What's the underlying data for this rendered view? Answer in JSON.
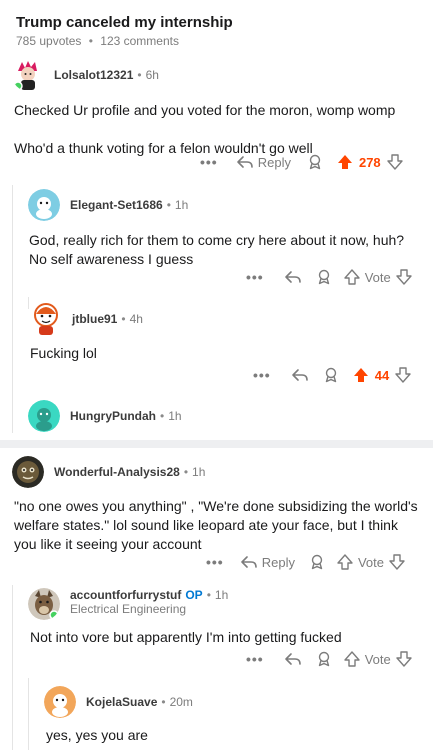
{
  "post": {
    "title": "Trump canceled my internship",
    "upvotes": "785 upvotes",
    "comments": "123 comments"
  },
  "comments": [
    {
      "author": "Lolsalot12321",
      "time": "6h",
      "body": [
        "Checked Ur profile and you voted for the moron, womp womp",
        "Who'd a thunk voting for a felon wouldn't go well"
      ],
      "reply_label": "Reply",
      "votes": "278"
    },
    {
      "author": "Elegant-Set1686",
      "time": "1h",
      "body": [
        "God, really rich for them to come cry here about it now, huh? No self awareness I guess"
      ],
      "votes": "Vote"
    },
    {
      "author": "jtblue91",
      "time": "4h",
      "body": [
        "Fucking lol"
      ],
      "votes": "44"
    },
    {
      "author": "HungryPundah",
      "time": "1h"
    },
    {
      "author": "Wonderful-Analysis28",
      "time": "1h",
      "body": [
        "\"no one owes you anything\" , \"We're done subsidizing the world's welfare states.\" lol sound like leopard ate your face, but I think you like it seeing your account"
      ],
      "reply_label": "Reply",
      "votes": "Vote"
    },
    {
      "author": "accountforfurrystuf",
      "op": "OP",
      "time": "1h",
      "flair": "Electrical Engineering",
      "body": [
        "Not into vore but apparently I'm into getting fucked"
      ],
      "votes": "Vote"
    },
    {
      "author": "KojelaSuave",
      "time": "20m",
      "body": [
        "yes, yes you are"
      ]
    }
  ],
  "icons": {
    "more": "more-icon",
    "reply": "reply-arrow-icon",
    "award": "award-icon",
    "upvote": "upvote-arrow-icon",
    "downvote": "downvote-arrow-icon"
  },
  "colors": {
    "upvote_active": "#ff4500",
    "op_badge": "#0079d3",
    "online": "#46d160"
  }
}
